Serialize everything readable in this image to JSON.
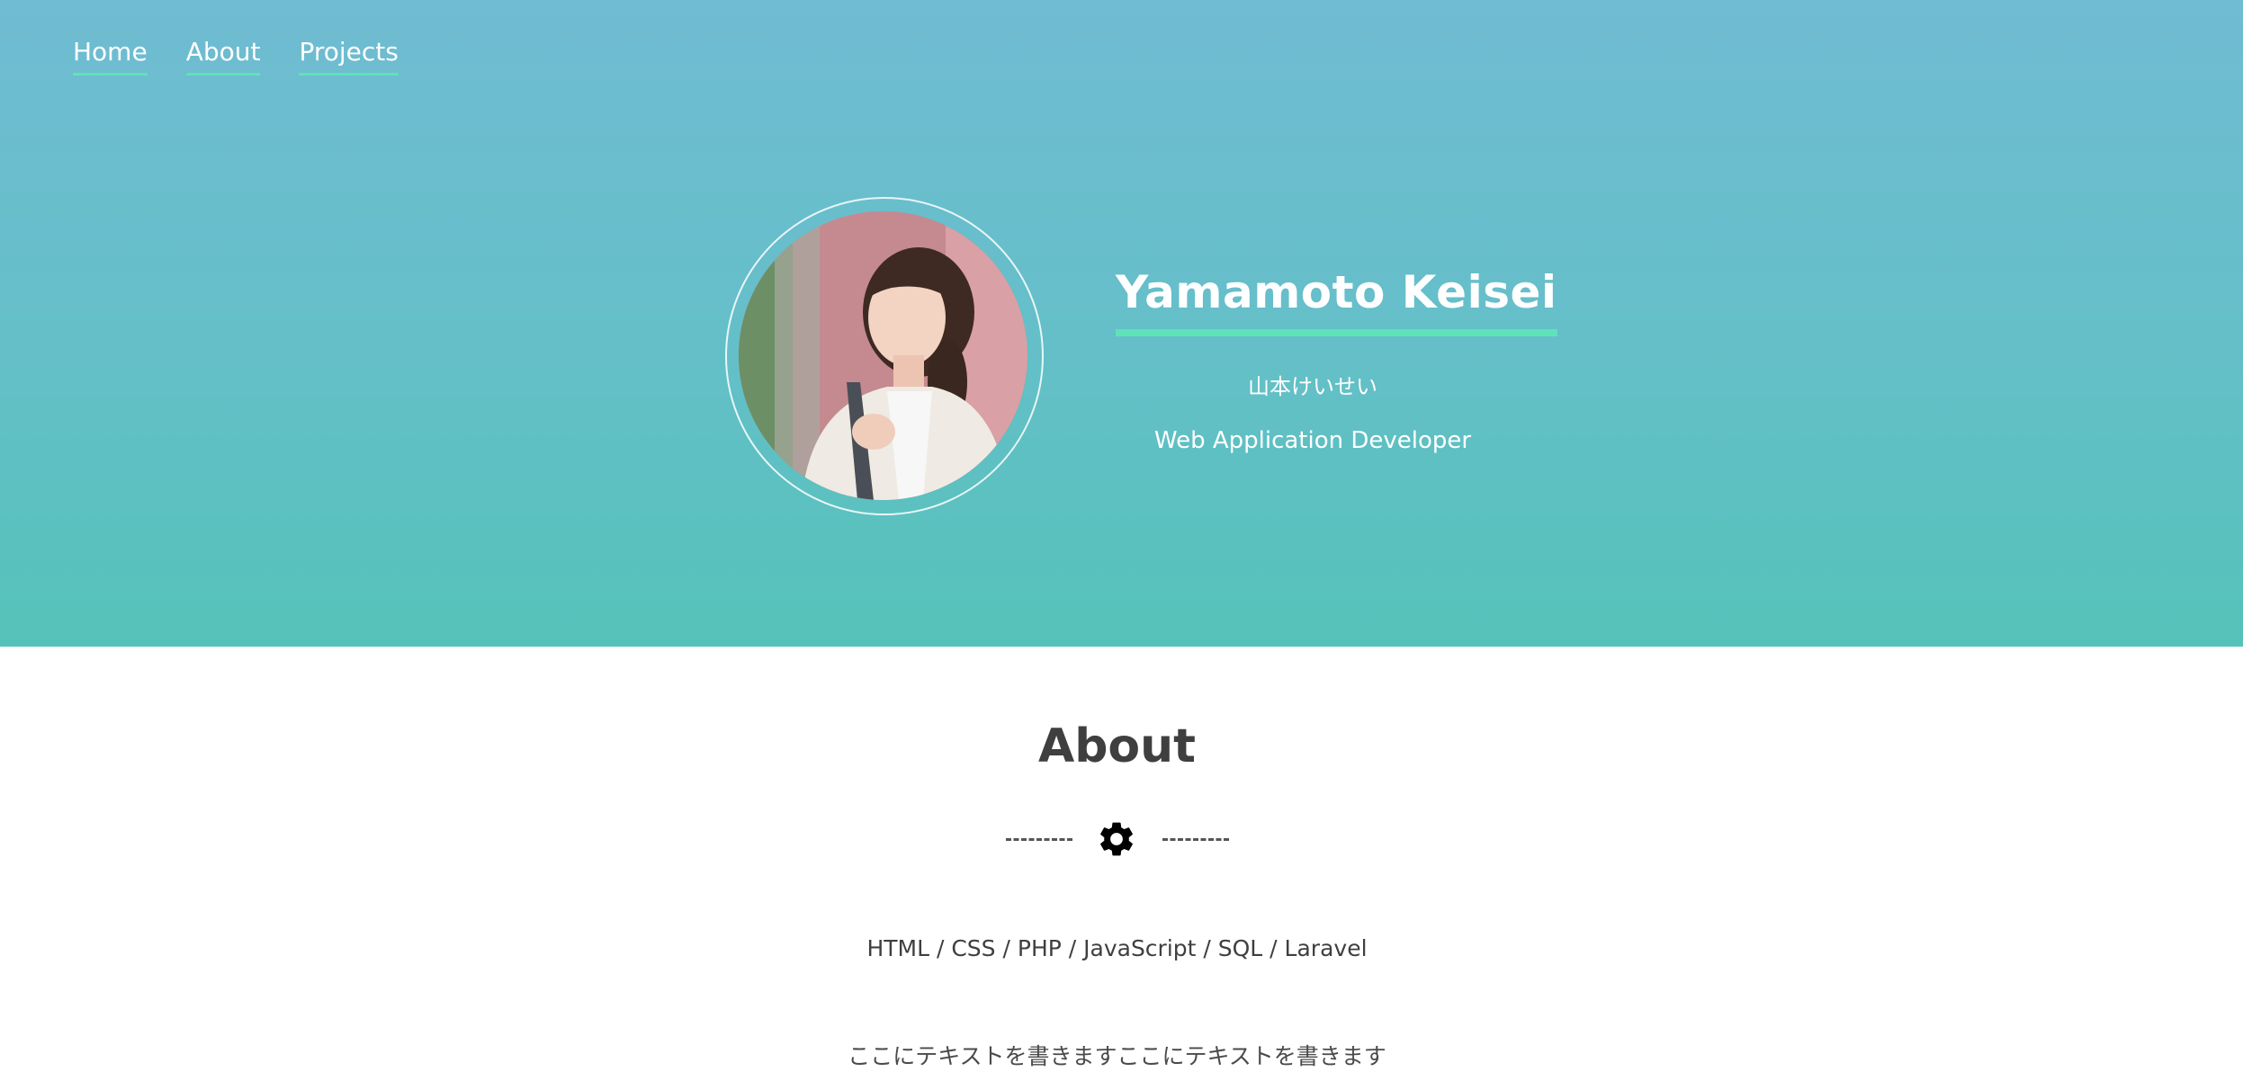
{
  "nav": {
    "items": [
      {
        "label": "Home"
      },
      {
        "label": "About"
      },
      {
        "label": "Projects"
      }
    ]
  },
  "hero": {
    "name": "Yamamoto Keisei",
    "name_kana": "山本けいせい",
    "role": "Web Application Developer",
    "avatar_alt": "profile photo"
  },
  "about": {
    "title": "About",
    "divider_icon": "gear-icon",
    "skills": "HTML / CSS / PHP / JavaScript / SQL / Laravel",
    "text": "ここにテキストを書きますここにテキストを書きます"
  },
  "colors": {
    "accent": "#5ee3b9",
    "hero_top": "#70bcd2",
    "hero_bottom": "#55c2b9",
    "heading": "#3f3f3f"
  }
}
